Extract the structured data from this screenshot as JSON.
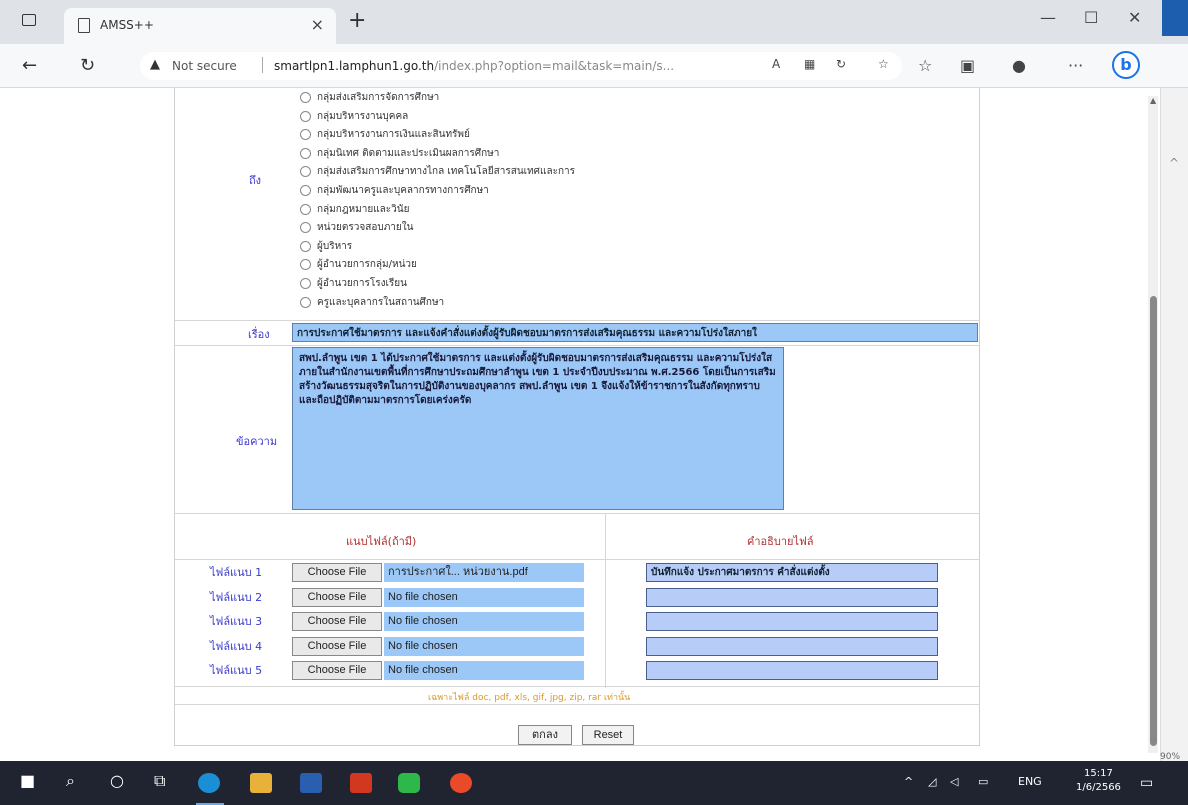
{
  "browser": {
    "tab_title": "AMSS++",
    "tab_close": "×",
    "new_tab": "+",
    "minimize": "—",
    "maximize": "☐",
    "close": "✕",
    "security_text": "Not secure",
    "url_host": "smartlpn1.lamphun1.go.th",
    "url_path": "/index.php?option=mail&task=main/s...",
    "bing_label": "b",
    "zoom": "90%"
  },
  "form": {
    "to_label": "ถึง",
    "recipient_groups": [
      "กลุ่มส่งเสริมการจัดการศึกษา",
      "กลุ่มบริหารงานบุคคล",
      "กลุ่มบริหารงานการเงินและสินทรัพย์",
      "กลุ่มนิเทศ ติดตามและประเมินผลการศึกษา",
      "กลุ่มส่งเสริมการศึกษาทางไกล เทคโนโลยีสารสนเทศและการ",
      "กลุ่มพัฒนาครูและบุคลากรทางการศึกษา",
      "กลุ่มกฎหมายและวินัย",
      "หน่วยตรวจสอบภายใน",
      "ผู้บริหาร",
      "ผู้อำนวยการกลุ่ม/หน่วย",
      "ผู้อำนวยการโรงเรียน",
      "ครูและบุคลากรในสถานศึกษา"
    ],
    "subject_label": "เรื่อง",
    "subject_value": "การประกาศใช้มาตรการ และแจ้งคำสั่งแต่งตั้งผู้รับผิดชอบมาตรการส่งเสริมคุณธรรม และความโปร่งใสภายใ",
    "message_label": "ข้อความ",
    "message_value": "สพป.ลำพูน เขต 1 ได้ประกาศใช้มาตรการ และแต่งตั้งผู้รับผิดชอบมาตรการส่งเสริมคุณธรรม และความโปร่งใสภายในสำนักงานเขตพื้นที่การศึกษาประถมศึกษาลำพูน เขต 1 ประจำปีงบประมาณ พ.ศ.2566 โดยเป็นการเสริมสร้างวัฒนธรรมสุจริตในการปฏิบัติงานของบุคลากร สพป.ลำพูน เขต 1 จึงแจ้งให้ข้าราชการในสังกัดทุกทราบ และถือปฏิบัติตามมาตรการโดยเคร่งครัด",
    "attach_header": "แนบไฟล์(ถ้ามี)",
    "desc_header": "คำอธิบายไฟล์",
    "files": [
      {
        "label": "ไฟล์แนบ 1",
        "button": "Choose File",
        "filename": "การประกาศใ... หน่วยงาน.pdf",
        "description": "บันทึกแจ้ง ประกาศมาตรการ คำสั่งแต่งตั้ง"
      },
      {
        "label": "ไฟล์แนบ 2",
        "button": "Choose File",
        "filename": "No file chosen",
        "description": ""
      },
      {
        "label": "ไฟล์แนบ 3",
        "button": "Choose File",
        "filename": "No file chosen",
        "description": ""
      },
      {
        "label": "ไฟล์แนบ 4",
        "button": "Choose File",
        "filename": "No file chosen",
        "description": ""
      },
      {
        "label": "ไฟล์แนบ 5",
        "button": "Choose File",
        "filename": "No file chosen",
        "description": ""
      }
    ],
    "file_note": "เฉพาะไฟล์ doc, pdf, xls, gif, jpg, zip, rar เท่านั้น",
    "submit_label": "ตกลง",
    "reset_label": "Reset"
  },
  "taskbar": {
    "lang": "ENG",
    "time": "15:17",
    "date": "1/6/2566"
  },
  "colors": {
    "field_bg": "#9cc8f7",
    "label_blue": "#3a3ad0",
    "header_red": "#b03030",
    "note_orange": "#d89a2a",
    "taskbar": "#1f2430"
  }
}
